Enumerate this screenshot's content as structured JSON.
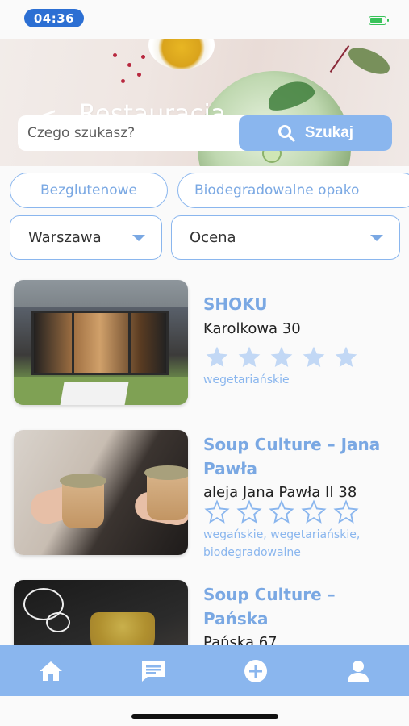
{
  "status_bar": {
    "time": "04:36"
  },
  "header": {
    "title": "Restauracja",
    "back_symbol": "<"
  },
  "search": {
    "placeholder": "Czego szukasz?",
    "button_label": "Szukaj"
  },
  "filters": {
    "chips": [
      "Bezglutenowe",
      "Biodegradowalne opako"
    ],
    "city_select": "Warszawa",
    "sort_select": "Ocena"
  },
  "restaurants": [
    {
      "name": "SHOKU",
      "address": "Karolkowa 30",
      "rating": 5,
      "star_style": "filled",
      "tags": "wegetariańskie"
    },
    {
      "name": "Soup Culture – Jana Pawła",
      "address": "aleja Jana Pawła II 38",
      "rating": 0,
      "star_style": "outline",
      "tags": "wegańskie, wegetariańskie, biodegradowalne"
    },
    {
      "name": "Soup Culture – Pańska",
      "address": "Pańska 67",
      "rating": 0,
      "star_style": "outline",
      "tags": ""
    }
  ],
  "tabbar": {
    "items": [
      {
        "icon": "home-icon"
      },
      {
        "icon": "chat-icon"
      },
      {
        "icon": "add-circle-icon"
      },
      {
        "icon": "profile-icon"
      }
    ]
  },
  "colors": {
    "accent": "#8ab6ee",
    "accent_text": "#7aa8e3",
    "time_pill": "#2c6fd3"
  }
}
